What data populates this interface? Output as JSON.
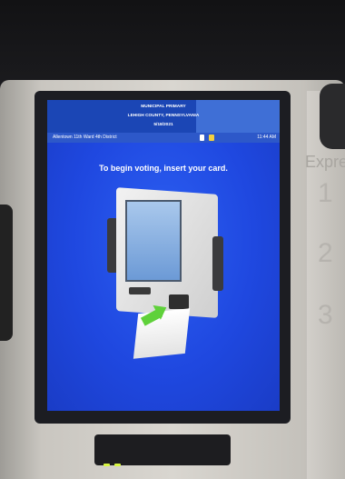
{
  "screen": {
    "header": {
      "line1": "MUNICIPAL PRIMARY",
      "line2": "LEHIGH COUNTY, PENNSYLVANIA",
      "line3": "5/18/2021"
    },
    "infobar": {
      "district": "Allentown 11th Ward 4th District",
      "time": "11:44 AM",
      "icons": [
        "printer-icon",
        "lock-icon"
      ]
    },
    "instruction": "To begin voting, insert your card."
  },
  "machine_side": {
    "brand_partial": "Expre",
    "numbers": [
      "1",
      "2",
      "3"
    ]
  },
  "colors": {
    "screen_blue": "#1f48e0",
    "header_blue": "#1b46b5",
    "arrow_green": "#5fd13a"
  }
}
